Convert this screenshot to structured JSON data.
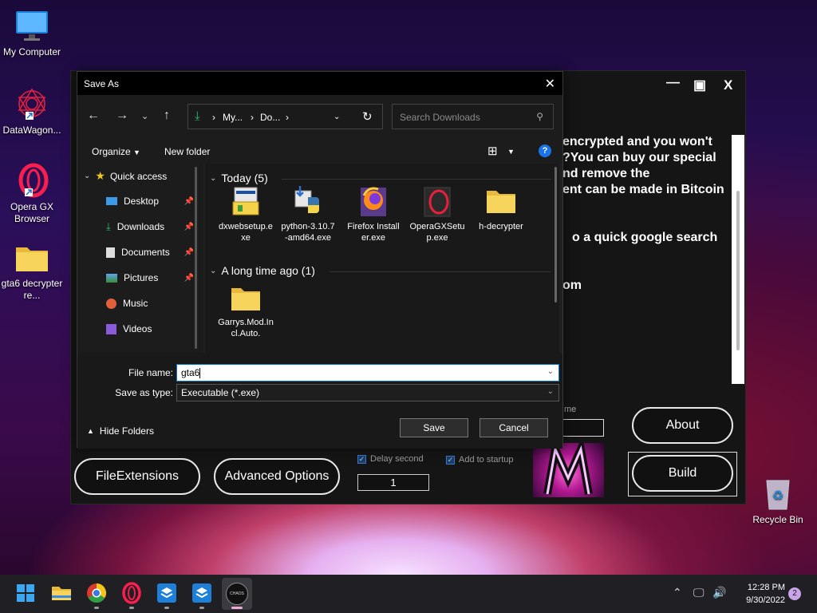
{
  "desktop": {
    "icons": [
      {
        "label": "My Computer"
      },
      {
        "label": "DataWagon..."
      },
      {
        "label": "Opera GX Browser"
      },
      {
        "label": "gta6 decrypter re..."
      },
      {
        "label": "Recycle Bin"
      }
    ]
  },
  "builder": {
    "window_controls": {
      "minimize": "—",
      "maximize": "▣",
      "close": "X"
    },
    "background_text": [
      "encrypted and you won't",
      "?You can buy our special",
      "nd remove the",
      "ent can be made in Bitcoin",
      "o a quick google search",
      "om"
    ],
    "partial_label": "me",
    "buttons": {
      "about": "About",
      "build": "Build",
      "file_extensions": "FileExtensions",
      "advanced_options": "Advanced Options"
    },
    "delay_second_label": "Delay second",
    "add_to_startup_label": "Add to startup",
    "delay_value": "1"
  },
  "dialog": {
    "title": "Save As",
    "address": {
      "part1": "My...",
      "part2": "Do..."
    },
    "search_placeholder": "Search Downloads",
    "organize": "Organize",
    "new_folder": "New folder",
    "nav": {
      "quick_access": "Quick access",
      "items": [
        {
          "label": "Desktop",
          "pinned": true
        },
        {
          "label": "Downloads",
          "pinned": true
        },
        {
          "label": "Documents",
          "pinned": true
        },
        {
          "label": "Pictures",
          "pinned": true
        },
        {
          "label": "Music",
          "pinned": false
        },
        {
          "label": "Videos",
          "pinned": false
        }
      ]
    },
    "groups": {
      "today": "Today (5)",
      "long_ago": "A long time ago (1)"
    },
    "files_today": [
      {
        "name": "dxwebsetup.exe",
        "icon": "setup-icon"
      },
      {
        "name": "python-3.10.7-amd64.exe",
        "icon": "python-icon"
      },
      {
        "name": "Firefox Installer.exe",
        "icon": "firefox-icon"
      },
      {
        "name": "OperaGXSetup.exe",
        "icon": "opera-icon"
      },
      {
        "name": "h-decrypter",
        "icon": "folder-icon"
      }
    ],
    "files_old": [
      {
        "name": "Garrys.Mod.Incl.Auto.",
        "icon": "folder-icon"
      }
    ],
    "file_name_label": "File name:",
    "file_name_value": "gta6",
    "save_type_label": "Save as type:",
    "save_type_value": "Executable (*.exe)",
    "hide_folders": "Hide Folders",
    "save_button": "Save",
    "cancel_button": "Cancel"
  },
  "taskbar": {
    "time": "12:28 PM",
    "date": "9/30/2022",
    "notification_count": "2",
    "apps": [
      "start-icon",
      "file-explorer-icon",
      "chrome-icon",
      "opera-icon",
      "app-box-icon",
      "app-box-icon",
      "chaos-icon"
    ],
    "chaos_label": "CHAOS"
  }
}
